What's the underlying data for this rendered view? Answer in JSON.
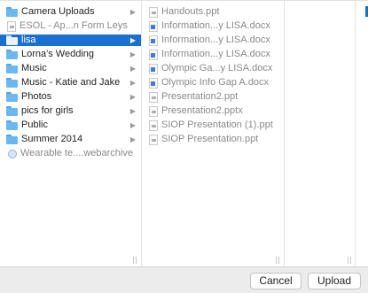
{
  "column1": {
    "items": [
      {
        "label": "Camera Uploads",
        "icon": "folder-icon",
        "arrow": "▶"
      },
      {
        "label": "ESOL  - Ap...n Form Leys",
        "icon": "document-icon",
        "arrow": "",
        "dim": true
      },
      {
        "label": "lisa",
        "icon": "folder-icon",
        "arrow": "▶",
        "selected": true
      },
      {
        "label": "Lorna's Wedding",
        "icon": "folder-icon",
        "arrow": "▶"
      },
      {
        "label": "Music",
        "icon": "folder-icon",
        "arrow": "▶"
      },
      {
        "label": "Music - Katie and Jake",
        "icon": "folder-icon",
        "arrow": "▶"
      },
      {
        "label": "Photos",
        "icon": "folder-icon",
        "arrow": "▶"
      },
      {
        "label": "pics for girls",
        "icon": "folder-icon",
        "arrow": "▶"
      },
      {
        "label": "Public",
        "icon": "folder-icon",
        "arrow": "▶"
      },
      {
        "label": "Summer 2014",
        "icon": "folder-icon",
        "arrow": "▶"
      },
      {
        "label": "Wearable te....webarchive",
        "icon": "webarchive-icon",
        "arrow": "",
        "dim": true
      }
    ]
  },
  "column2": {
    "items": [
      {
        "label": "Handouts.ppt",
        "icon": "presentation-icon"
      },
      {
        "label": "Information...y LISA.docx",
        "icon": "word-document-icon"
      },
      {
        "label": "Information...y LISA.docx",
        "icon": "word-document-icon"
      },
      {
        "label": "Information...y LISA.docx",
        "icon": "word-document-icon"
      },
      {
        "label": "Olympic Ga...y LISA.docx",
        "icon": "word-document-icon"
      },
      {
        "label": "Olympic Info Gap A.docx",
        "icon": "word-document-icon"
      },
      {
        "label": "Presentation2.ppt",
        "icon": "presentation-icon"
      },
      {
        "label": "Presentation2.pptx",
        "icon": "presentation-icon"
      },
      {
        "label": "SIOP Presentation (1).ppt",
        "icon": "presentation-icon"
      },
      {
        "label": "SIOP Presentation.ppt",
        "icon": "presentation-icon"
      }
    ]
  },
  "footer": {
    "cancel_label": "Cancel",
    "upload_label": "Upload"
  },
  "colors": {
    "selection": "#1a6fd0",
    "folder": "#6bb7f1"
  }
}
